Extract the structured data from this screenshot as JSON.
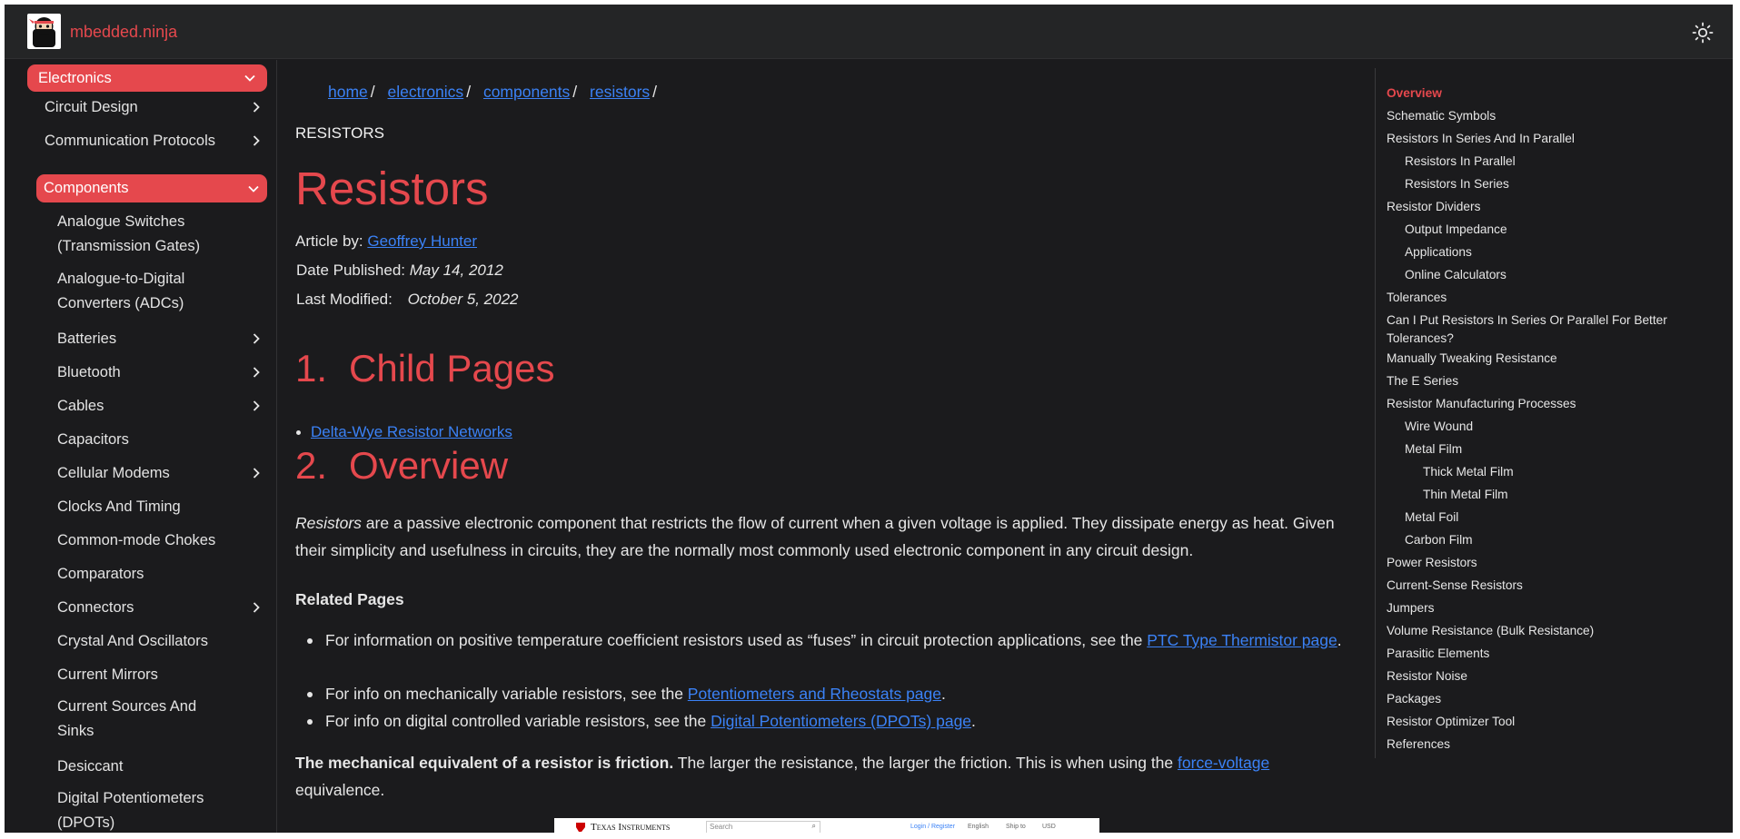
{
  "header": {
    "site_name": "mbedded.ninja",
    "logo": "ninja-logo",
    "theme_icon": "sun-icon"
  },
  "sidebar": {
    "items": [
      {
        "label": "Electronics",
        "active": true,
        "chevron": "down"
      },
      {
        "label": "Circuit Design",
        "chevron": "right"
      },
      {
        "label": "Communication Protocols",
        "chevron": "right"
      },
      {
        "label": "Components",
        "active": true,
        "chevron": "down"
      },
      {
        "label": "Analogue Switches (Transmission Gates)"
      },
      {
        "label": "Analogue-to-Digital Converters (ADCs)"
      },
      {
        "label": "Batteries",
        "chevron": "right"
      },
      {
        "label": "Bluetooth",
        "chevron": "right"
      },
      {
        "label": "Cables",
        "chevron": "right"
      },
      {
        "label": "Capacitors"
      },
      {
        "label": "Cellular Modems",
        "chevron": "right"
      },
      {
        "label": "Clocks And Timing"
      },
      {
        "label": "Common-mode Chokes"
      },
      {
        "label": "Comparators"
      },
      {
        "label": "Connectors",
        "chevron": "right"
      },
      {
        "label": "Crystal And Oscillators"
      },
      {
        "label": "Current Mirrors"
      },
      {
        "label": "Current Sources And Sinks"
      },
      {
        "label": "Desiccant"
      },
      {
        "label": "Digital Potentiometers (DPOTs)"
      }
    ]
  },
  "breadcrumb": [
    "home",
    "electronics",
    "components",
    "resistors"
  ],
  "article": {
    "kicker": "RESISTORS",
    "title": "Resistors",
    "author_label": "Article by:",
    "author": "Geoffrey Hunter",
    "published_label": "Date Published:",
    "published": "May 14, 2012",
    "modified_label": "Last Modified:",
    "modified": "October 5, 2022",
    "sections": [
      {
        "number": "1.",
        "title": "Child Pages"
      },
      {
        "number": "2.",
        "title": "Overview"
      }
    ],
    "child_pages": [
      "Delta-Wye Resistor Networks"
    ],
    "overview_em": "Resistors",
    "overview_text": " are a passive electronic component that restricts the flow of current when a given voltage is applied. They dissipate energy as heat. Given their simplicity and usefulness in circuits, they are the normally most commonly used electronic component in any circuit design.",
    "related_heading": "Related Pages",
    "related": [
      {
        "text": "For information on positive temperature coefficient resistors used as “fuses” in circuit protection applications, see the ",
        "link": "PTC Type Thermistor page",
        "after": "."
      },
      {
        "text": "For info on mechanically variable resistors, see the ",
        "link": "Potentiometers and Rheostats page",
        "after": "."
      },
      {
        "text": "For info on digital controlled variable resistors, see the ",
        "link": "Digital Potentiometers (DPOTs) page",
        "after": "."
      }
    ],
    "mech_bold": "The mechanical equivalent of a resistor is friction.",
    "mech_text": " The larger the resistance, the larger the friction. This is when using the ",
    "mech_link": "force-voltage",
    "mech_after": " equivalence.",
    "figure": {
      "brand": "Texas Instruments",
      "search_placeholder": "Search",
      "login": "Login / Register",
      "language": "English",
      "ship": "Ship to",
      "currency": "USD"
    }
  },
  "toc": {
    "items": [
      {
        "label": "Overview",
        "level": 1,
        "current": true
      },
      {
        "label": "Schematic Symbols",
        "level": 1
      },
      {
        "label": "Resistors In Series And In Parallel",
        "level": 1
      },
      {
        "label": "Resistors In Parallel",
        "level": 2
      },
      {
        "label": "Resistors In Series",
        "level": 2
      },
      {
        "label": "Resistor Dividers",
        "level": 1
      },
      {
        "label": "Output Impedance",
        "level": 2
      },
      {
        "label": "Applications",
        "level": 2
      },
      {
        "label": "Online Calculators",
        "level": 2
      },
      {
        "label": "Tolerances",
        "level": 1
      },
      {
        "label": "Can I Put Resistors In Series Or Parallel For Better Tolerances?",
        "level": 1
      },
      {
        "label": "Manually Tweaking Resistance",
        "level": 1
      },
      {
        "label": "The E Series",
        "level": 1
      },
      {
        "label": "Resistor Manufacturing Processes",
        "level": 1
      },
      {
        "label": "Wire Wound",
        "level": 2
      },
      {
        "label": "Metal Film",
        "level": 2
      },
      {
        "label": "Thick Metal Film",
        "level": 3
      },
      {
        "label": "Thin Metal Film",
        "level": 3
      },
      {
        "label": "Metal Foil",
        "level": 2
      },
      {
        "label": "Carbon Film",
        "level": 2
      },
      {
        "label": "Power Resistors",
        "level": 1
      },
      {
        "label": "Current-Sense Resistors",
        "level": 1
      },
      {
        "label": "Jumpers",
        "level": 1
      },
      {
        "label": "Volume Resistance (Bulk Resistance)",
        "level": 1
      },
      {
        "label": "Parasitic Elements",
        "level": 1
      },
      {
        "label": "Resistor Noise",
        "level": 1
      },
      {
        "label": "Packages",
        "level": 1
      },
      {
        "label": "Resistor Optimizer Tool",
        "level": 1
      },
      {
        "label": "References",
        "level": 1
      }
    ]
  },
  "colors": {
    "accent": "#e5484d",
    "link": "#3b82f6",
    "background": "#1b1b1d",
    "header": "#242526"
  }
}
